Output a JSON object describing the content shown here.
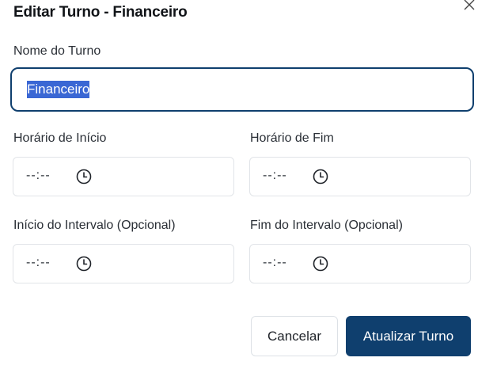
{
  "dialog": {
    "title": "Editar Turno - Financeiro",
    "close_icon": "close-icon"
  },
  "form": {
    "shift_name": {
      "label": "Nome do Turno",
      "value": "Financeiro"
    },
    "start_time": {
      "label": "Horário de Início",
      "value": "--:--",
      "icon": "clock-icon"
    },
    "end_time": {
      "label": "Horário de Fim",
      "value": "--:--",
      "icon": "clock-icon"
    },
    "break_start": {
      "label": "Início do Intervalo (Opcional)",
      "value": "--:--",
      "icon": "clock-icon"
    },
    "break_end": {
      "label": "Fim do Intervalo (Opcional)",
      "value": "--:--",
      "icon": "clock-icon"
    }
  },
  "actions": {
    "cancel_label": "Cancelar",
    "submit_label": "Atualizar Turno"
  },
  "colors": {
    "primary": "#0f3f6e",
    "selection": "#3a67d4",
    "border": "#e1e4e8"
  }
}
